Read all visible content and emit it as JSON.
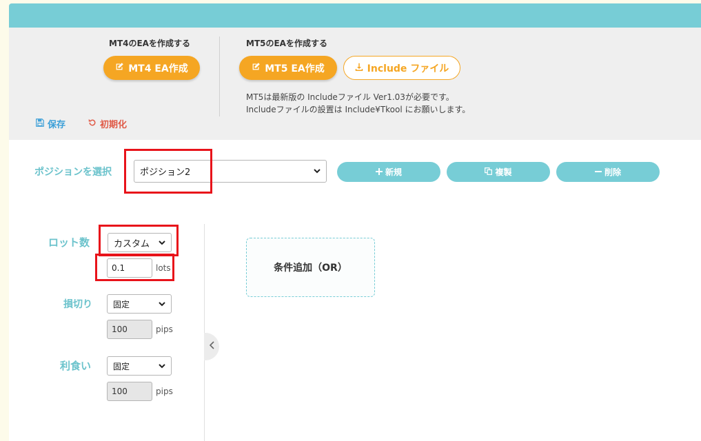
{
  "header": {
    "mt4": {
      "title": "MT4のEAを作成する",
      "button": "MT4 EA作成"
    },
    "mt5": {
      "title": "MT5のEAを作成する",
      "button": "MT5 EA作成",
      "include_button": "Include ファイル",
      "note_line1": "MT5は最新版の Includeファイル Ver1.03が必要です。",
      "note_line2": "Includeファイルの設置は Include¥Tkool にお願いします。"
    },
    "save": "保存",
    "reset": "初期化"
  },
  "position": {
    "label": "ポジションを選択",
    "selected": "ポジション2",
    "new": "新規",
    "copy": "複製",
    "delete": "削除"
  },
  "settings": {
    "lot": {
      "label": "ロット数",
      "mode": "カスタム",
      "value": "0.1",
      "unit": "lots"
    },
    "stoploss": {
      "label": "損切り",
      "mode": "固定",
      "value": "100",
      "unit": "pips"
    },
    "takeprofit": {
      "label": "利食い",
      "mode": "固定",
      "value": "100",
      "unit": "pips"
    }
  },
  "condition": {
    "add_label": "条件追加（OR）"
  },
  "colors": {
    "accent_teal": "#77cdd6",
    "accent_orange": "#f5a623",
    "highlight_red": "#e8131a",
    "save_blue": "#3b9fd8",
    "reset_red": "#e05a47"
  },
  "icons": [
    "edit-icon",
    "download-icon",
    "save-icon",
    "undo-icon",
    "plus-icon",
    "copy-icon",
    "minus-icon",
    "chevron-down-icon",
    "chevron-left-icon"
  ]
}
